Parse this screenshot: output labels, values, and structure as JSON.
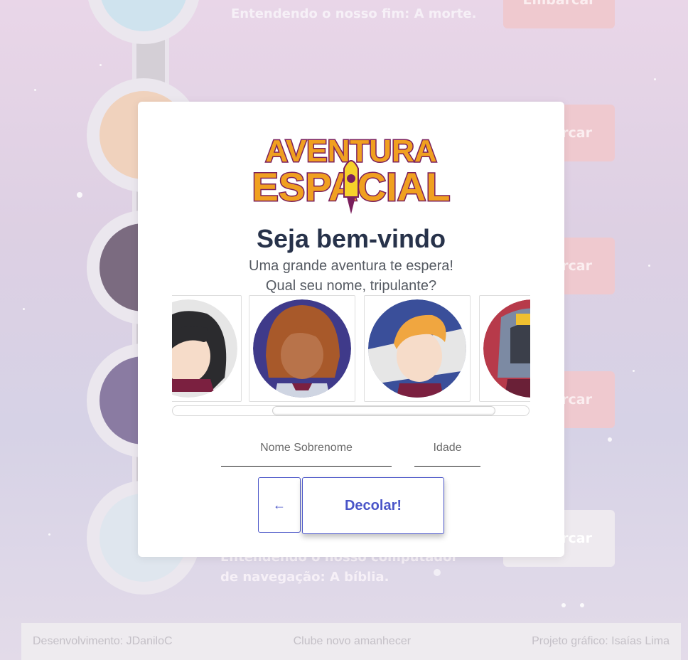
{
  "background": {
    "lessons": [
      {
        "text": "Entendendo o nosso fim: A morte.",
        "button": "Embarcar"
      },
      {
        "text": "",
        "button": "rcar"
      },
      {
        "text": "",
        "button": "rcar"
      },
      {
        "text": "",
        "button": "rcar"
      },
      {
        "text": "Entendendo o nosso computador de navegação: A bíblia.",
        "button": "rcar"
      }
    ]
  },
  "modal": {
    "logo": {
      "line1": "AVENTURA",
      "line2": "ESPACIAL"
    },
    "title": "Seja bem-vindo",
    "subtitle1": "Uma grande aventura te espera!",
    "subtitle2": "Qual seu nome, tripulante?",
    "avatars": [
      "girl-black-hair-avatar",
      "girl-dreadlocks-avatar",
      "boy-blonde-avatar",
      "astronaut-helmet-avatar"
    ],
    "name_placeholder": "Nome Sobrenome",
    "age_placeholder": "Idade",
    "back_icon": "←",
    "submit_label": "Decolar!"
  },
  "footer": {
    "left": "Desenvolvimento: JDaniloC",
    "center": "Clube novo amanhecer",
    "right": "Projeto gráfico: Isaías Lima"
  },
  "colors": {
    "accent": "#4a55c8",
    "title": "#27324a"
  }
}
